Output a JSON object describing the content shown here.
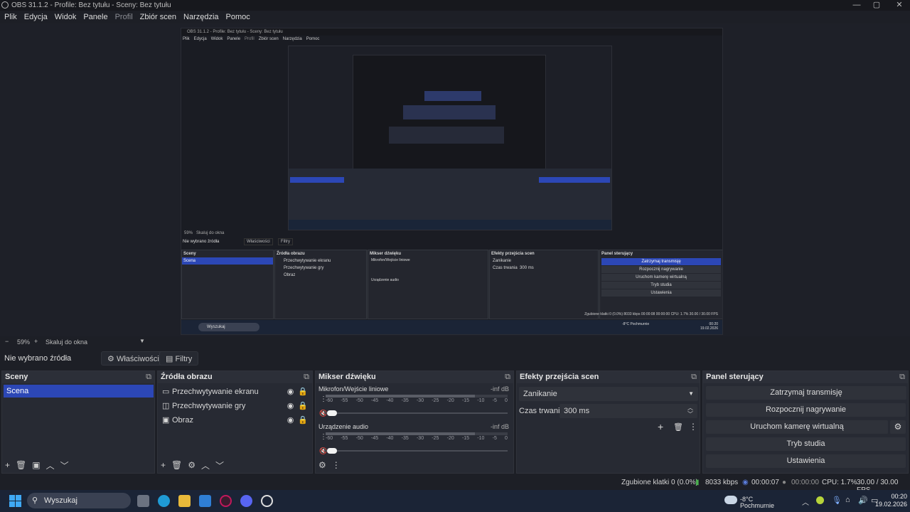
{
  "window": {
    "title": "OBS 31.1.2 - Profile: Bez tytułu - Sceny: Bez tytułu",
    "min": "—",
    "max": "▢",
    "close": "✕"
  },
  "menu": [
    "Plik",
    "Edycja",
    "Widok",
    "Panele",
    "Profil",
    "Zbiór scen",
    "Narzędzia",
    "Pomoc"
  ],
  "nested_window": {
    "title": "OBS 31.1.2 - Profile: Bez tytułu - Sceny: Bez tytułu",
    "menu": [
      "Plik",
      "Edycja",
      "Widok",
      "Panele",
      "Profil",
      "Zbiór scen",
      "Narzędzia",
      "Pomoc"
    ],
    "zoom": "59%",
    "scale": "Skaluj do okna",
    "no_source": "Nie wybrano źródła",
    "properties": "Właściwości",
    "filters": "Filtry",
    "scenes_title": "Sceny",
    "scene": "Scena",
    "sources_title": "Źródła obrazu",
    "sources": [
      "Przechwytywanie ekranu",
      "Przechwytywanie gry",
      "Obraz"
    ],
    "mixer_title": "Mikser dźwięku",
    "mic": "Mikrofon/Wejście liniowe",
    "desktop": "Urządzenie audio",
    "transition_title": "Efekty przejścia scen",
    "transition": "Zanikanie",
    "duration_label": "Czas trwania",
    "duration": "300 ms",
    "controls_title": "Panel sterujący",
    "controls": [
      "Zatrzymaj transmisję",
      "Rozpocznij nagrywanie",
      "Uruchom kamerę wirtualną",
      "Tryb studia",
      "Ustawienia"
    ],
    "status": "Zgubione klatki 0 (0.0%)   8033 kbps   00:00:08   00:00:00   CPU: 1.7%   30.00 / 30.00 FPS",
    "search": "Wyszukaj",
    "weather": "-8°C Pochmurnie",
    "time": "00:20",
    "date": "19.02.2026"
  },
  "zoombar": {
    "minus": "−",
    "zoom": "59%",
    "plus": "+",
    "scale_mode": "Skaluj do okna"
  },
  "source_toolbar": {
    "no_source": "Nie wybrano źródła",
    "properties_label": "Właściwości",
    "filters_label": "Filtry"
  },
  "scenes": {
    "title": "Sceny",
    "items": [
      "Scena"
    ],
    "selected": 0
  },
  "sources": {
    "title": "Źródła obrazu",
    "items": [
      {
        "name": "Przechwytywanie ekranu",
        "icon": "monitor-icon"
      },
      {
        "name": "Przechwytywanie gry",
        "icon": "gamepad-icon"
      },
      {
        "name": "Obraz",
        "icon": "image-icon"
      }
    ]
  },
  "mixer": {
    "title": "Mikser dźwięku",
    "channels": [
      {
        "name": "Mikrofon/Wejście liniowe",
        "level": "-inf dB"
      },
      {
        "name": "Urządzenie audio",
        "level": "-inf dB"
      }
    ],
    "ticks": [
      "-60",
      "-55",
      "-50",
      "-45",
      "-40",
      "-35",
      "-30",
      "-25",
      "-20",
      "-15",
      "-10",
      "-5",
      "0"
    ]
  },
  "transitions": {
    "title": "Efekty przejścia scen",
    "selected": "Zanikanie",
    "duration_label": "Czas trwania",
    "duration": "300 ms"
  },
  "controls": {
    "title": "Panel sterujący",
    "stream": "Zatrzymaj transmisję",
    "record": "Rozpocznij nagrywanie",
    "virtualcam": "Uruchom kamerę wirtualną",
    "studio": "Tryb studia",
    "settings": "Ustawienia"
  },
  "statusbar": {
    "dropped": "Zgubione klatki 0 (0.0%)",
    "bitrate": "8033 kbps",
    "stream_time": "00:00:07",
    "rec_time": "00:00:00",
    "cpu": "CPU: 1.7%",
    "fps": "30.00 / 30.00 FPS"
  },
  "taskbar": {
    "search": "Wyszukaj",
    "temp": "-8°C",
    "weather": "Pochmurnie",
    "time": "00:20",
    "date": "19.02.2026"
  },
  "colors": {
    "accent": "#2c47b6",
    "bg": "#1d1f26",
    "dock": "#272a33",
    "taskbar": "#1b2436"
  }
}
